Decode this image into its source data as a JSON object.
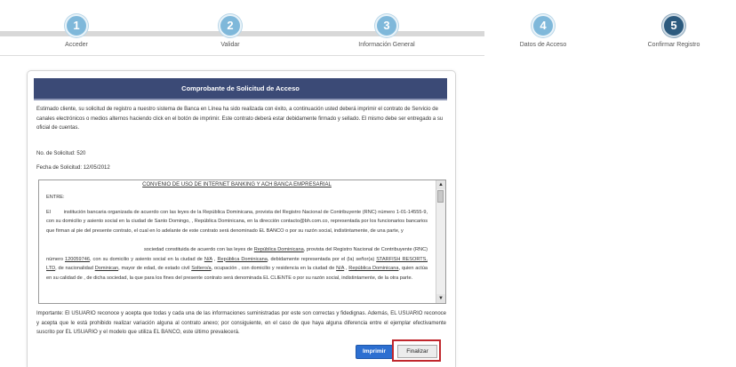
{
  "stepper": {
    "steps": [
      {
        "number": "1",
        "label": "Acceder"
      },
      {
        "number": "2",
        "label": "Validar"
      },
      {
        "number": "3",
        "label": "Información General"
      },
      {
        "number": "4",
        "label": "Datos de Acceso"
      },
      {
        "number": "5",
        "label": "Confirmar Registro"
      }
    ],
    "current_step": 5
  },
  "panel": {
    "title": "Comprobante de Solicitud de Acceso",
    "intro": "Estimado cliente, su solicitud de registro a nuestro sistema de Banca en Línea ha sido realizada con éxito, a continuación usted deberá imprimir el contrato de Servicio de canales electrónicos o medios alternos haciendo click en el botón de imprimir. Este contrato deberá estar debidamente firmado y sellado. El mismo debe ser entregado a su oficial de cuentas.",
    "request_number": "No. de Solicitud: 520",
    "request_date": "Fecha de Solicitud: 12/05/2012"
  },
  "contract": {
    "title": "CONVENIO DE USO DE INTERNET BANKING Y ACH BANCA EMPRESARIAL",
    "between": "ENTRE:",
    "p1": {
      "a": "El",
      "b": "institución bancaria organizada de acuerdo con las leyes de la República Dominicana, provista del Registro Nacional de Contribuyente (RNC) número 1-01-14555-9, con su domicilio y asiento social en la ciudad de Santo Domingo, , República Dominicana, en la dirección contacto@bh.com.co, representada por los funcionarios bancarios que firman al pie del presente contrato, el cual en lo adelante de este contrato será denominado EL BANCO o por su razón social, indistintamente, de una parte, y"
    },
    "p2": {
      "a": "sociedad constituida de acuerdo con las leyes de",
      "country1": "República Dominicana",
      "b": ", provista del Registro Nacional de Contribuyente (RNC) número",
      "rnc": "120059746",
      "c": ", con su domicilio y asiento social en la ciudad de",
      "na1": "N/A",
      "d": ",",
      "country2": "República Dominicana",
      "e": ", debidamente representada por el (la) señor(a)",
      "company": "STARFISH RESORTS, LTD",
      "f": ", de nacionalidad",
      "nationality": "Dominican",
      "g": ", mayor de edad, de estado civil",
      "civil": "Soltero/a",
      "h": ", ocupación , con domicilio y residencia en la ciudad de",
      "na2": "N/A",
      "i": ",",
      "country3": "República Dominicana",
      "j": ", quien actúa en su calidad de , de dicha sociedad, la que para los fines del presente contrato será denominada EL CLIENTE o por su razón social, indistintamente, de la otra parte."
    }
  },
  "notice": "Importante: El USUARIO reconoce y acepta que todas y cada una de las informaciones suministradas por este son correctas y fidedignas. Además, EL USUARIO reconoce y acepta que le está prohibido realizar variación alguna al contrato anexo; por consiguiente, en el caso de que haya alguna diferencia entre el ejemplar efectivamente suscrito por EL USUARIO y el modelo que utiliza EL BANCO, este último prevalecerá.",
  "buttons": {
    "print": "Imprimir",
    "finish": "Finalizar"
  },
  "icons": {
    "scroll_up": "scroll-up-arrow-icon",
    "scroll_down": "scroll-down-arrow-icon"
  },
  "colors": {
    "header": "#3b4a76",
    "step_done": "#7fb8da",
    "step_current": "#2c5a7e",
    "print_button": "#2c6fd1",
    "highlight_border": "#c0272d"
  }
}
